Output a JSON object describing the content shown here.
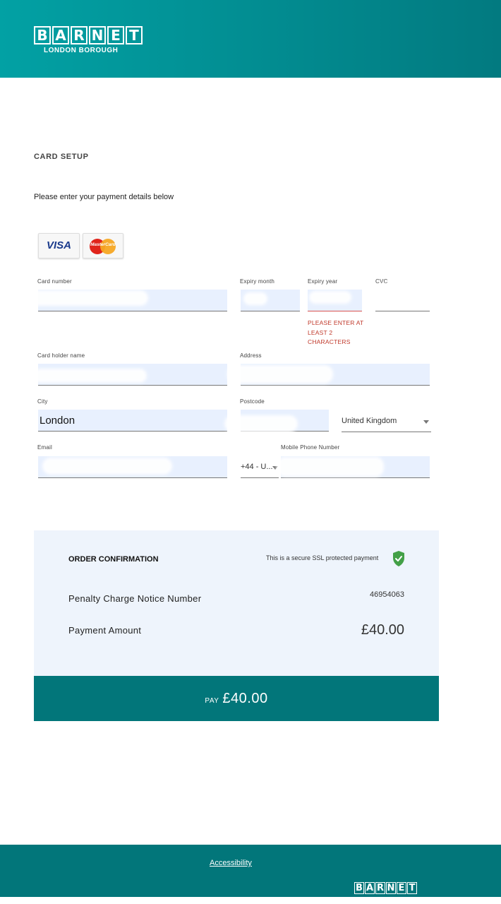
{
  "header": {
    "logo_letters": [
      "B",
      "A",
      "R",
      "N",
      "E",
      "T"
    ],
    "logo_sub": "LONDON BOROUGH"
  },
  "page": {
    "title": "CARD SETUP",
    "subtitle": "Please enter your payment details below"
  },
  "card_brands": {
    "visa": "VISA",
    "mastercard": "MasterCard"
  },
  "form": {
    "card_number": {
      "label": "Card number",
      "value": ""
    },
    "expiry_month": {
      "label": "Expiry month",
      "value": ""
    },
    "expiry_year": {
      "label": "Expiry year",
      "value": "",
      "error": "PLEASE ENTER AT LEAST 2 CHARACTERS"
    },
    "cvc": {
      "label": "CVC",
      "value": ""
    },
    "card_holder": {
      "label": "Card holder name",
      "value": ""
    },
    "address": {
      "label": "Address",
      "value": ""
    },
    "city": {
      "label": "City",
      "value": "London"
    },
    "postcode": {
      "label": "Postcode",
      "value": ""
    },
    "country": {
      "value": "United Kingdom"
    },
    "email": {
      "label": "Email",
      "value": ""
    },
    "phone_code": {
      "value": "+44 - U..."
    },
    "mobile": {
      "label": "Mobile Phone Number",
      "value": ""
    }
  },
  "order": {
    "title": "ORDER CONFIRMATION",
    "ssl_text": "This is a secure SSL protected payment",
    "pcn_label": "Penalty Charge Notice Number",
    "pcn_value": "46954063",
    "amount_label": "Payment Amount",
    "amount_value": "£40.00"
  },
  "pay_button": {
    "word": "PAY",
    "amount": "£40.00"
  },
  "footer": {
    "link": "Accessibility",
    "logo_letters": [
      "B",
      "A",
      "R",
      "N",
      "E",
      "T"
    ]
  },
  "colors": {
    "brand_teal": "#02767a",
    "header_gradient_start": "#02a1a4",
    "error_red": "#c0392b",
    "shield_green": "#43a047"
  }
}
